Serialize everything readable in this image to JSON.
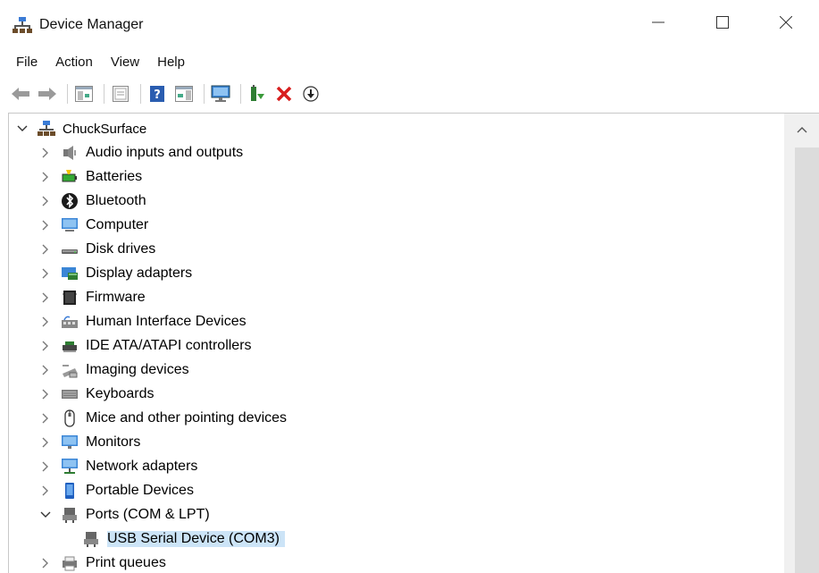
{
  "window": {
    "title": "Device Manager"
  },
  "menu": {
    "items": [
      "File",
      "Action",
      "View",
      "Help"
    ]
  },
  "toolbar": {
    "buttons": [
      "back-icon",
      "forward-icon",
      "show-hide-tree-icon",
      "properties-icon",
      "help-icon",
      "action-pane-icon",
      "scan-hardware-icon",
      "update-driver-icon",
      "uninstall-icon",
      "disable-device-icon"
    ]
  },
  "tree": {
    "root": "ChuckSurface",
    "items": [
      "Audio inputs and outputs",
      "Batteries",
      "Bluetooth",
      "Computer",
      "Disk drives",
      "Display adapters",
      "Firmware",
      "Human Interface Devices",
      "IDE ATA/ATAPI controllers",
      "Imaging devices",
      "Keyboards",
      "Mice and other pointing devices",
      "Monitors",
      "Network adapters",
      "Portable Devices",
      "Ports (COM & LPT)",
      "Print queues"
    ],
    "expanded_child": "USB Serial Device (COM3)"
  }
}
